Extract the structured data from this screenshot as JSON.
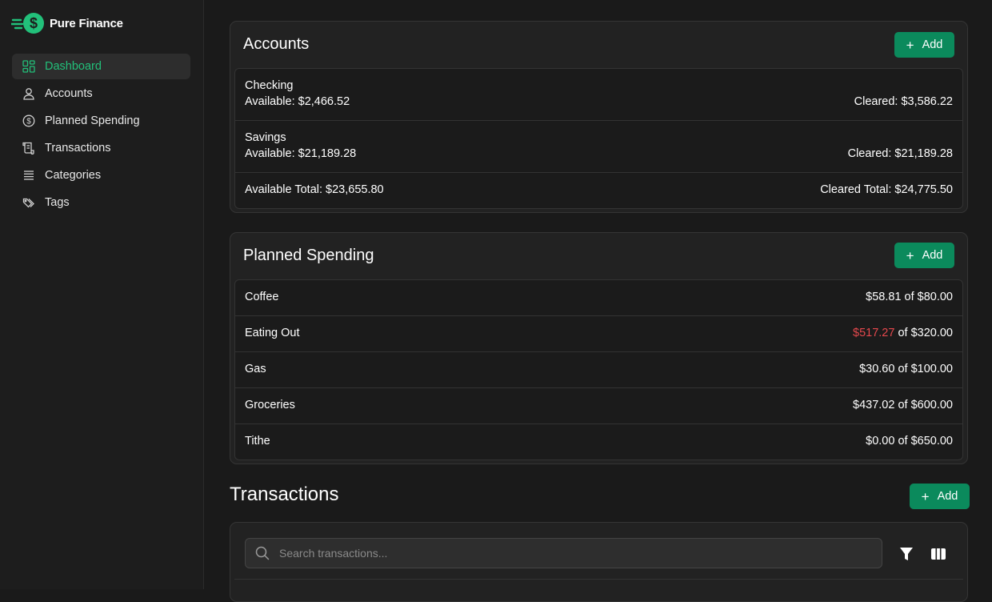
{
  "brand": {
    "name": "Pure Finance",
    "logo_icon": "dollar-coin-icon",
    "accent": "#22c07a"
  },
  "sidebar": {
    "items": [
      {
        "label": "Dashboard",
        "icon": "dashboard-icon",
        "active": true
      },
      {
        "label": "Accounts",
        "icon": "user-icon"
      },
      {
        "label": "Planned Spending",
        "icon": "dollar-circle-icon"
      },
      {
        "label": "Transactions",
        "icon": "receipt-icon"
      },
      {
        "label": "Categories",
        "icon": "list-icon"
      },
      {
        "label": "Tags",
        "icon": "tags-icon"
      }
    ]
  },
  "accounts": {
    "title": "Accounts",
    "add_label": "Add",
    "rows": [
      {
        "name": "Checking",
        "available": "Available: $2,466.52",
        "cleared": "Cleared: $3,586.22"
      },
      {
        "name": "Savings",
        "available": "Available: $21,189.28",
        "cleared": "Cleared: $21,189.28"
      }
    ],
    "available_total": "Available Total: $23,655.80",
    "cleared_total": "Cleared Total: $24,775.50"
  },
  "planned": {
    "title": "Planned Spending",
    "add_label": "Add",
    "rows": [
      {
        "name": "Coffee",
        "spent": "$58.81",
        "of": " of $80.00",
        "over": false
      },
      {
        "name": "Eating Out",
        "spent": "$517.27",
        "of": " of $320.00",
        "over": true
      },
      {
        "name": "Gas",
        "spent": "$30.60",
        "of": " of $100.00",
        "over": false
      },
      {
        "name": "Groceries",
        "spent": "$437.02",
        "of": " of $600.00",
        "over": false
      },
      {
        "name": "Tithe",
        "spent": "$0.00",
        "of": " of $650.00",
        "over": false
      }
    ],
    "over_color": "#e5484d"
  },
  "transactions": {
    "title": "Transactions",
    "add_label": "Add",
    "search_placeholder": "Search transactions...",
    "filter_icon": "filter-icon",
    "columns_icon": "columns-icon"
  }
}
